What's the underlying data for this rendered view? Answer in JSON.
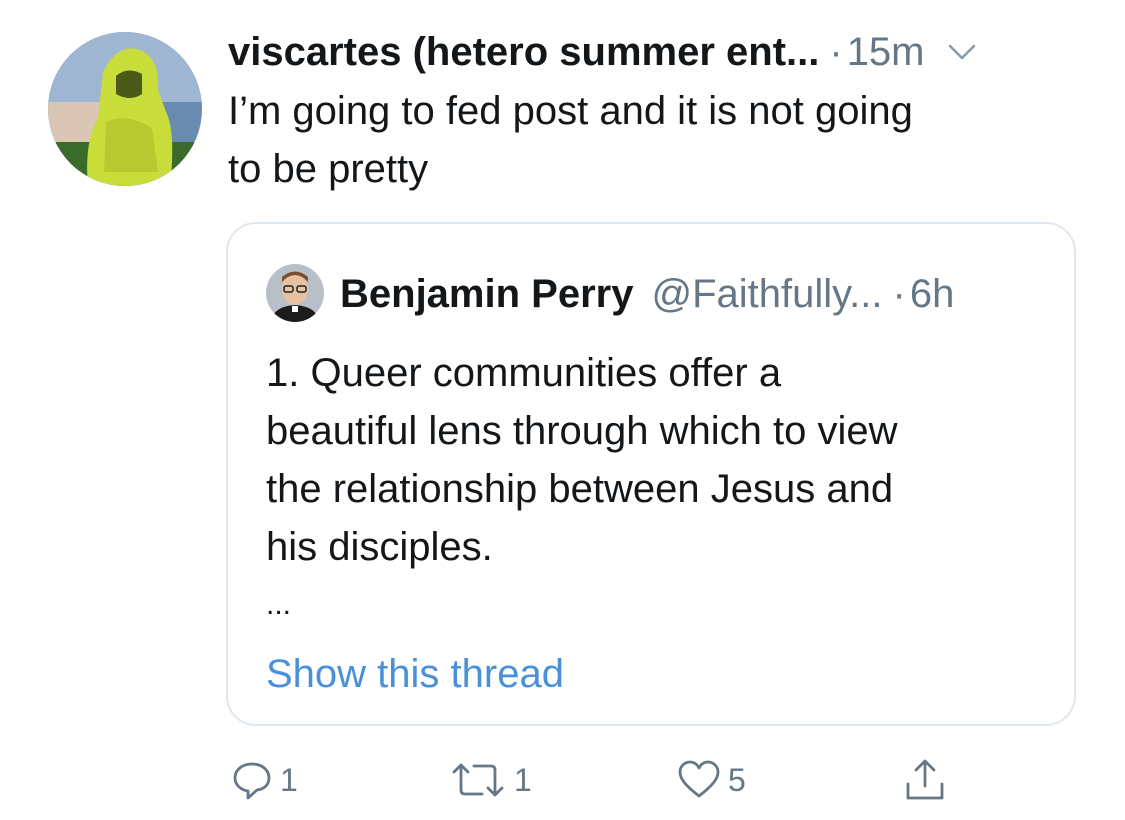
{
  "tweet": {
    "display_name": "viscartes (hetero summer ent...",
    "separator": "·",
    "timestamp": "15m",
    "text_line1": "I’m going to fed post and it is not going",
    "text_line2": "to be pretty"
  },
  "quoted_tweet": {
    "display_name": "Benjamin Perry",
    "handle": "@Faithfully...",
    "separator": "·",
    "timestamp": "6h",
    "text_lines": [
      "1. Queer communities offer a",
      "beautiful lens through which to view",
      "the relationship between Jesus and",
      "his disciples."
    ],
    "ellipsis": "...",
    "show_thread_label": "Show this thread"
  },
  "actions": {
    "reply_count": "1",
    "retweet_count": "1",
    "like_count": "5"
  },
  "colors": {
    "primary_text": "#14171a",
    "secondary_text": "#657786",
    "link": "#4a90d9",
    "border": "#e1e8ed"
  },
  "icons": {
    "avatar": "hooded-figure-avatar",
    "caret": "chevron-down-icon",
    "reply": "reply-icon",
    "retweet": "retweet-icon",
    "like": "heart-icon",
    "share": "share-icon"
  }
}
